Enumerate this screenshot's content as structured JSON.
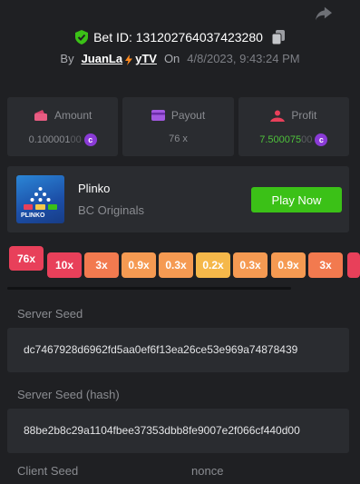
{
  "header": {
    "share_icon": "share-icon",
    "shield_icon": "shield-check-icon",
    "bet_id": "Bet ID: 131202764037423280",
    "copy_icon": "copy-icon",
    "by_label": "By",
    "username_left": "JuanLa",
    "username_right": "yTV",
    "on_label": "On",
    "date": "4/8/2023, 9:43:24 PM"
  },
  "stats": {
    "amount": {
      "label": "Amount",
      "value_main": "0.100001",
      "value_dim": "00",
      "icon": "wallet-icon",
      "coin": "c"
    },
    "payout": {
      "label": "Payout",
      "value": "76 x",
      "icon": "card-icon"
    },
    "profit": {
      "label": "Profit",
      "value_main": "7.500075",
      "value_dim": "00",
      "icon": "profit-icon",
      "coin": "c"
    }
  },
  "game": {
    "thumb_text": "PLINKO",
    "name": "Plinko",
    "provider": "BC Originals",
    "play_label": "Play Now"
  },
  "multipliers": [
    "76x",
    "10x",
    "3x",
    "0.9x",
    "0.3x",
    "0.2x",
    "0.3x",
    "0.9x",
    "3x"
  ],
  "colors": {
    "accent_green": "#3bc117",
    "coin_purple": "#8a3bd6",
    "mult_red": "#e8405a",
    "mult_orange": "#f27a4f",
    "mult_peach": "#f59a52",
    "mult_yellow": "#f5b84a"
  },
  "seeds": {
    "server_seed_label": "Server Seed",
    "server_seed": "dc7467928d6962fd5aa0ef6f13ea26ce53e969a74878439",
    "server_hash_label": "Server Seed (hash)",
    "server_hash": "88be2b8c29a1104fbee37353dbb8fe9007e2f066cf440d00",
    "client_seed_label": "Client Seed",
    "nonce_label": "nonce"
  }
}
